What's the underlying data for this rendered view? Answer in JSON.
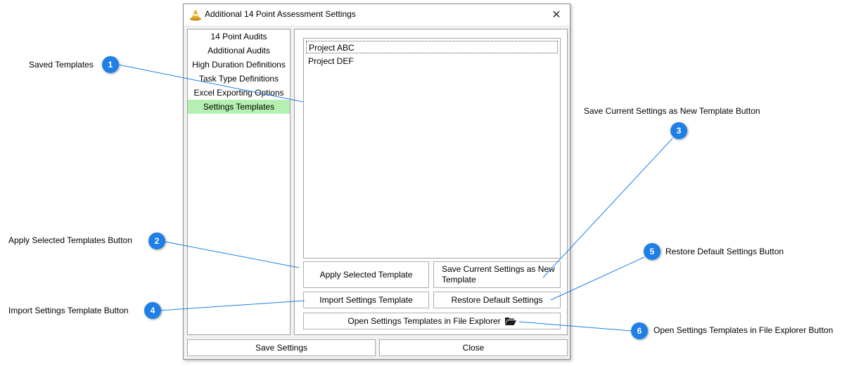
{
  "window": {
    "title": "Additional 14 Point Assessment Settings",
    "close_glyph": "✕"
  },
  "nav": {
    "items": [
      {
        "label": "14 Point Audits",
        "selected": false
      },
      {
        "label": "Additional Audits",
        "selected": false
      },
      {
        "label": "High Duration Definitions",
        "selected": false
      },
      {
        "label": "Task Type Definitions",
        "selected": false
      },
      {
        "label": "Excel Exporting Options",
        "selected": false
      },
      {
        "label": "Settings Templates",
        "selected": true
      }
    ]
  },
  "templates": {
    "items": [
      "Project ABC",
      "Project DEF"
    ]
  },
  "buttons": {
    "apply": "Apply Selected Template",
    "save_new": "Save Current Settings as New Template",
    "import": "Import Settings Template",
    "restore": "Restore Default Settings",
    "open_explorer": "Open Settings Templates in File Explorer"
  },
  "footer": {
    "save": "Save Settings",
    "close": "Close"
  },
  "callouts": [
    {
      "number": "1",
      "label": "Saved Templates"
    },
    {
      "number": "2",
      "label": "Apply Selected Templates Button"
    },
    {
      "number": "3",
      "label": "Save Current Settings as New Template Button"
    },
    {
      "number": "4",
      "label": "Import Settings Template Button"
    },
    {
      "number": "5",
      "label": "Restore Default Settings Button"
    },
    {
      "number": "6",
      "label": "Open Settings Templates in File Explorer Button"
    }
  ],
  "colors": {
    "selected_nav": "#b3f0b1",
    "callout_badge": "#1e7fe6",
    "leader_line": "#1e7fe6"
  },
  "icons": {
    "title": "cone-icon",
    "folder": "folder-open-icon"
  }
}
